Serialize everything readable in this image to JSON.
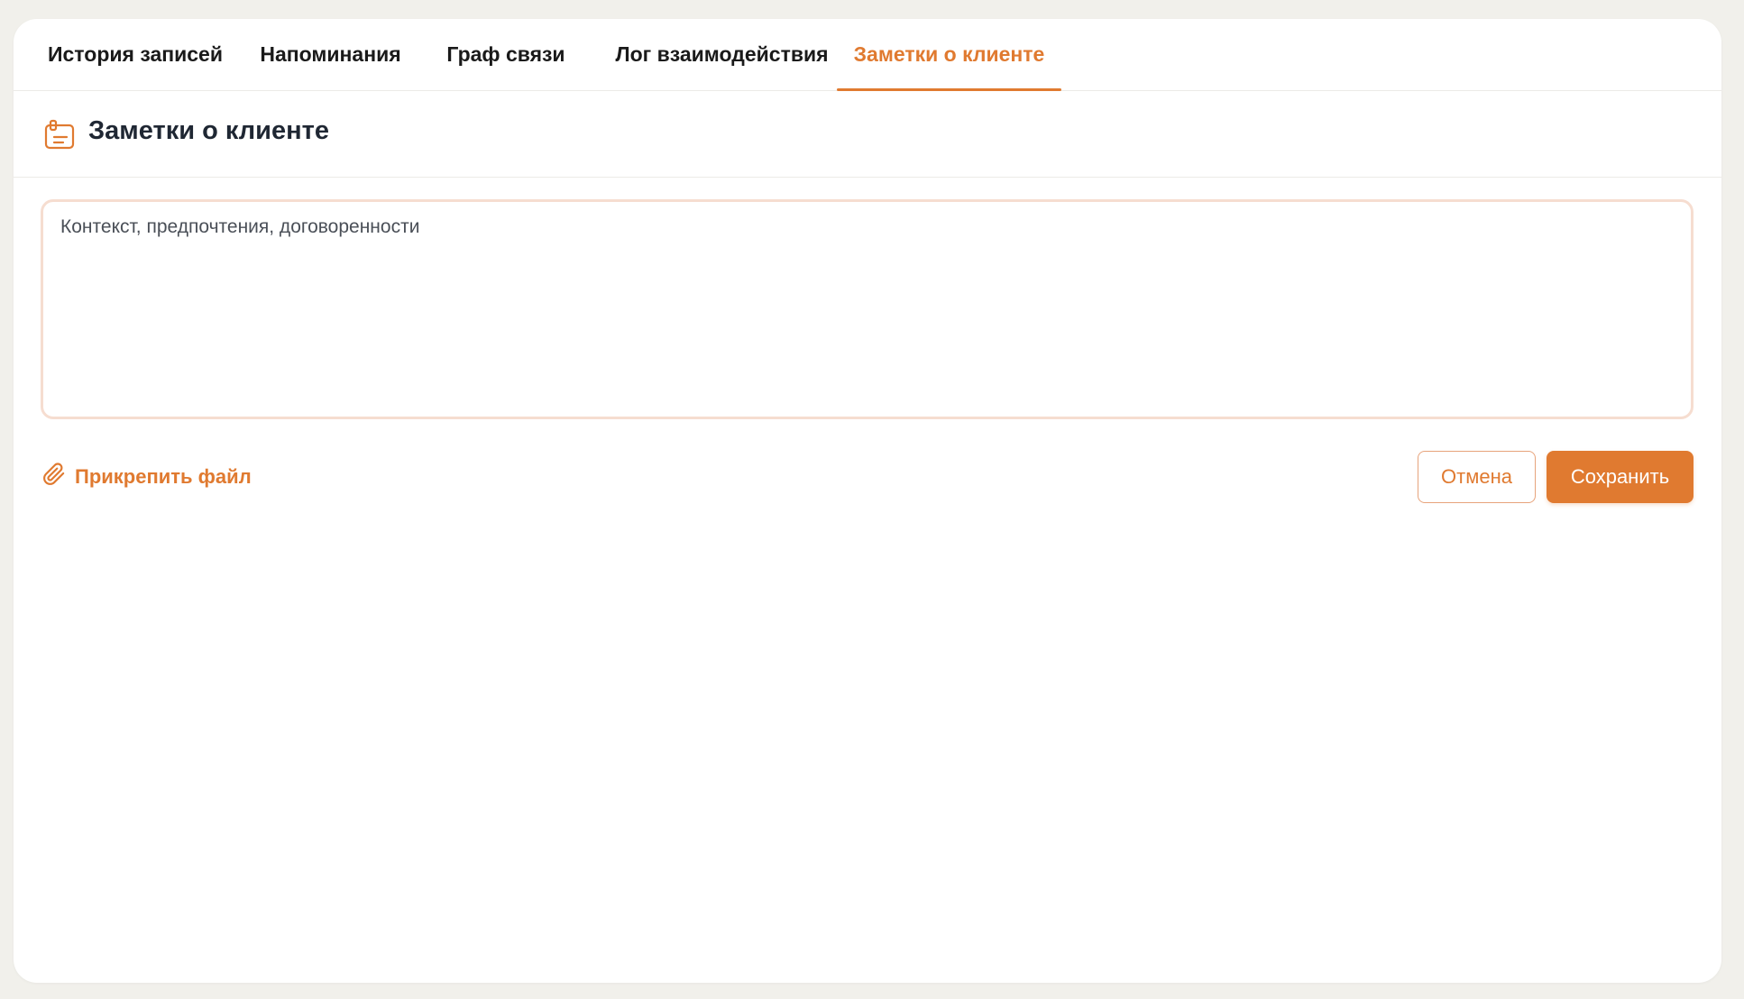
{
  "tabs": [
    {
      "label": "История записей",
      "active": false
    },
    {
      "label": "Напоминания",
      "active": false
    },
    {
      "label": "Граф связи",
      "active": false
    },
    {
      "label": "Лог взаимодействия",
      "active": false
    },
    {
      "label": "Заметки о клиенте",
      "active": true
    }
  ],
  "section": {
    "title": "Заметки о клиенте",
    "icon": "clipboard-note-icon"
  },
  "notes": {
    "value": "",
    "placeholder": "Контекст, предпочтения, договоренности"
  },
  "attach": {
    "label": "Прикрепить файл",
    "icon": "paperclip-icon"
  },
  "actions": {
    "cancel_label": "Отмена",
    "save_label": "Сохранить"
  },
  "colors": {
    "accent": "#e07a30",
    "background": "#f1f0eb",
    "card": "#ffffff",
    "text": "#1a1a1a"
  }
}
